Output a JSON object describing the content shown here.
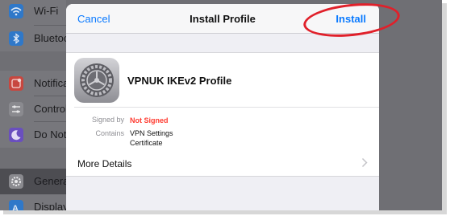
{
  "settings": {
    "items": [
      {
        "label": "Wi-Fi",
        "icon": "wifi-icon",
        "color": "#2f78c9"
      },
      {
        "label": "Bluetoo",
        "icon": "bluetooth-icon",
        "color": "#2f78c9"
      },
      {
        "label": "Notifica",
        "icon": "notifications-icon",
        "color": "#c8473f"
      },
      {
        "label": "Control",
        "icon": "control-center-icon",
        "color": "#8a8a8f"
      },
      {
        "label": "Do Not",
        "icon": "moon-icon",
        "color": "#6a4fbf"
      },
      {
        "label": "Genera",
        "icon": "gear-icon",
        "color": "#8a8a8f"
      },
      {
        "label": "Display",
        "icon": "display-icon",
        "color": "#2f78c9"
      }
    ],
    "selected": "Genera"
  },
  "sheet": {
    "cancel_label": "Cancel",
    "title": "Install Profile",
    "install_label": "Install",
    "profile_name": "VPNUK IKEv2 Profile",
    "profile_icon": "settings-gear-icon",
    "signed_by_label": "Signed by",
    "signed_by_value": "Not Signed",
    "contains_label": "Contains",
    "contains_values": [
      "VPN Settings",
      "Certificate"
    ],
    "more_details_label": "More Details"
  },
  "colors": {
    "accent": "#0a7aff",
    "warning": "#ff3b30",
    "highlight_ellipse": "#e0202a"
  }
}
